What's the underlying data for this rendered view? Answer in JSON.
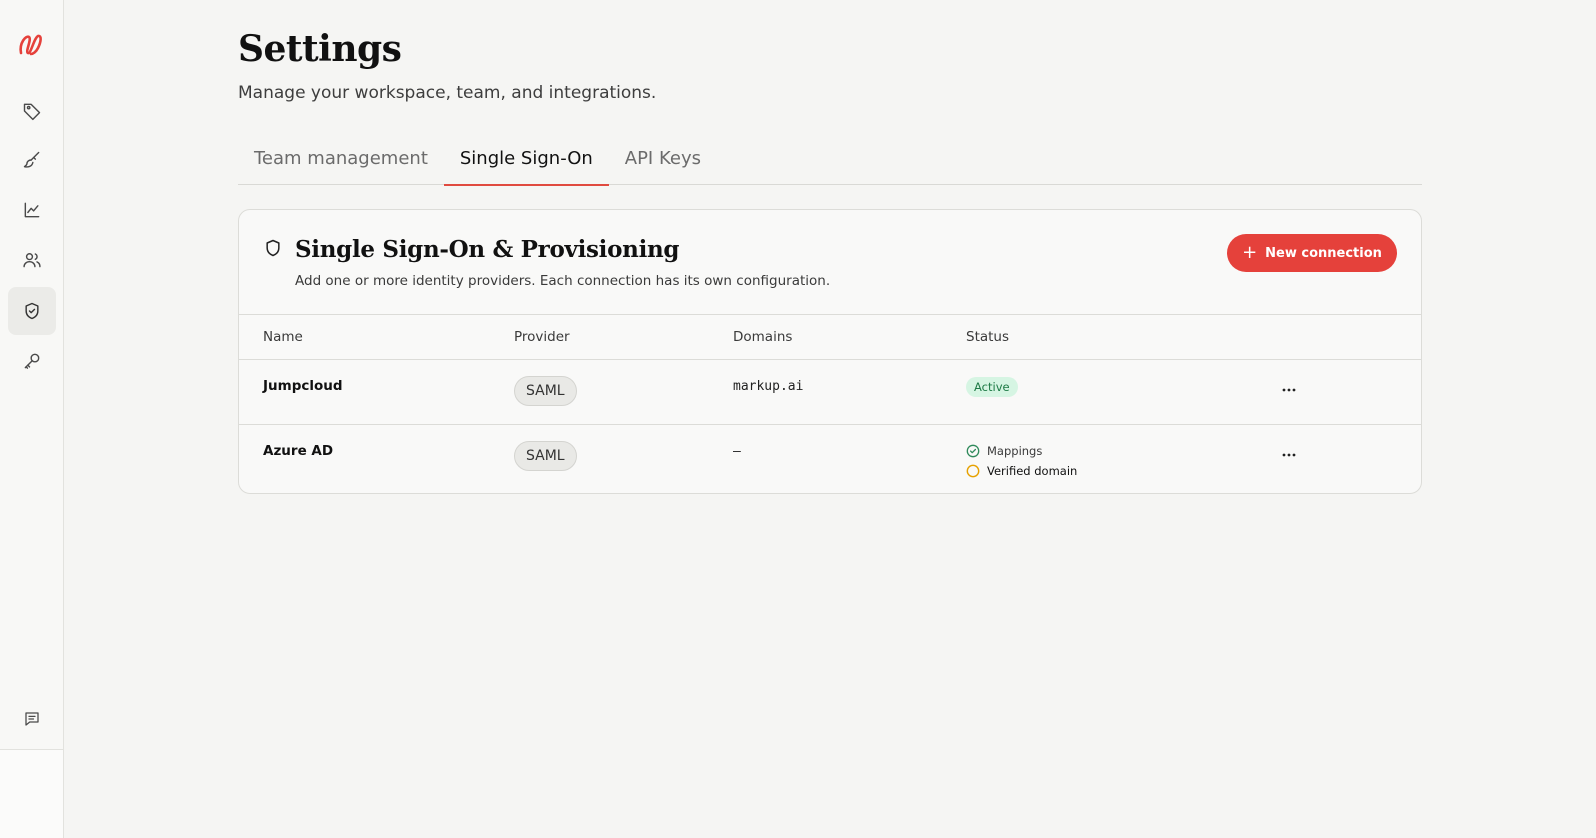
{
  "sidebar": {
    "items": [
      {
        "icon": "tag-icon",
        "name": "sidebar-item-tags"
      },
      {
        "icon": "brush-icon",
        "name": "sidebar-item-brush"
      },
      {
        "icon": "chart-line-icon",
        "name": "sidebar-item-analytics"
      },
      {
        "icon": "users-icon",
        "name": "sidebar-item-team"
      },
      {
        "icon": "shield-icon",
        "name": "sidebar-item-security",
        "active": true
      },
      {
        "icon": "key-icon",
        "name": "sidebar-item-keys"
      }
    ],
    "bottom_icon": "message-icon"
  },
  "header": {
    "title": "Settings",
    "subtitle": "Manage your workspace, team, and integrations."
  },
  "tabs": [
    {
      "label": "Team management"
    },
    {
      "label": "Single Sign-On",
      "active": true
    },
    {
      "label": "API Keys"
    }
  ],
  "sso": {
    "title": "Single Sign-On & Provisioning",
    "description": "Add one or more identity providers. Each connection has its own configuration.",
    "new_button": "New connection",
    "columns": {
      "name": "Name",
      "provider": "Provider",
      "domains": "Domains",
      "status": "Status"
    },
    "rows": [
      {
        "name": "Jumpcloud",
        "provider": "SAML",
        "domains": "markup.ai",
        "status": "Active"
      },
      {
        "name": "Azure AD",
        "provider": "SAML",
        "domains": "—",
        "status_items": [
          "Mappings",
          "Verified domain"
        ]
      }
    ]
  },
  "colors": {
    "accent": "#e5413b",
    "active_badge_bg": "#d6f5e3",
    "active_badge_text": "#1d7a45",
    "pending": "#e6a100",
    "ok": "#2f8a5b"
  }
}
